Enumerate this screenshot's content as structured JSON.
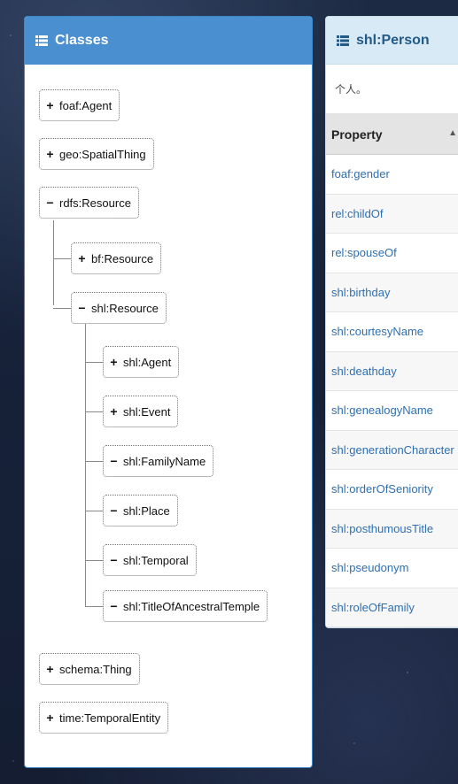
{
  "classes_panel": {
    "title": "Classes",
    "tree": [
      {
        "symbol": "+",
        "label": "foaf:Agent"
      },
      {
        "symbol": "+",
        "label": "geo:SpatialThing"
      },
      {
        "symbol": "−",
        "label": "rdfs:Resource"
      },
      {
        "symbol": "+",
        "label": "bf:Resource"
      },
      {
        "symbol": "−",
        "label": "shl:Resource"
      },
      {
        "symbol": "+",
        "label": "shl:Agent"
      },
      {
        "symbol": "+",
        "label": "shl:Event"
      },
      {
        "symbol": "−",
        "label": "shl:FamilyName"
      },
      {
        "symbol": "−",
        "label": "shl:Place"
      },
      {
        "symbol": "−",
        "label": "shl:Temporal"
      },
      {
        "symbol": "−",
        "label": "shl:TitleOfAncestralTemple"
      },
      {
        "symbol": "+",
        "label": "schema:Thing"
      },
      {
        "symbol": "+",
        "label": "time:TemporalEntity"
      }
    ]
  },
  "detail_panel": {
    "title": "shl:Person",
    "description": "个人。",
    "table_header": "Property",
    "properties": [
      "foaf:gender",
      "rel:childOf",
      "rel:spouseOf",
      "shl:birthday",
      "shl:courtesyName",
      "shl:deathday",
      "shl:genealogyName",
      "shl:generationCharacter",
      "shl:orderOfSeniority",
      "shl:posthumousTitle",
      "shl:pseudonym",
      "shl:roleOfFamily"
    ]
  },
  "colors": {
    "classes_header": "#4a8fd0",
    "detail_header": "#d7eaf6",
    "link": "#2f6fb0"
  }
}
